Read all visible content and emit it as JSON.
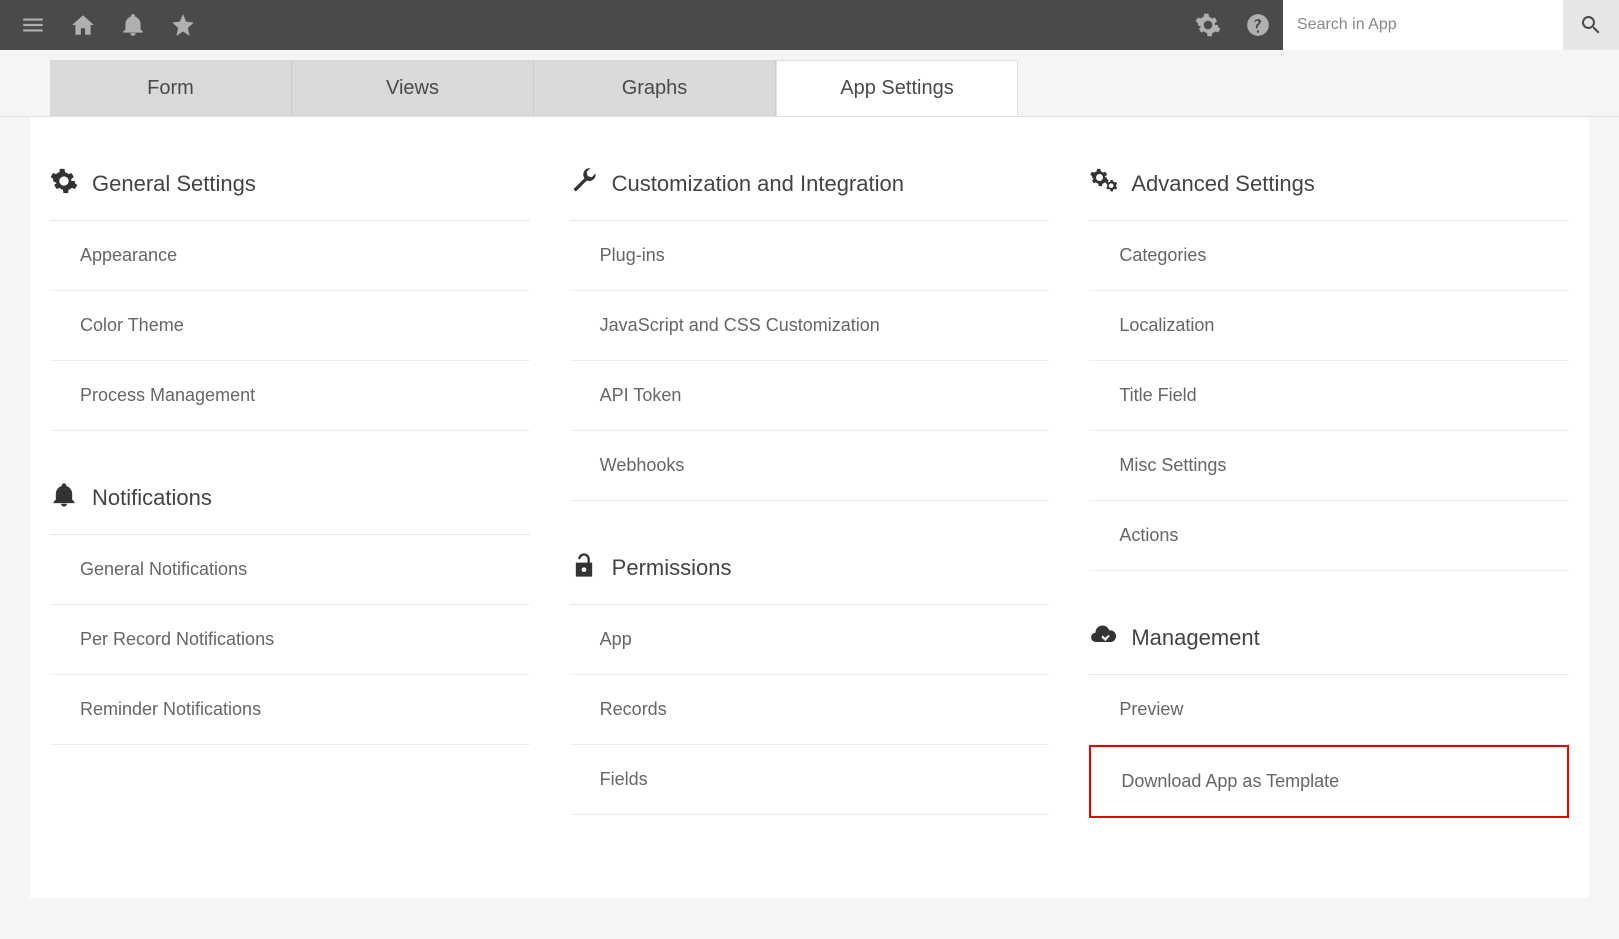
{
  "header": {
    "search_placeholder": "Search in App"
  },
  "tabs": [
    {
      "label": "Form",
      "active": false
    },
    {
      "label": "Views",
      "active": false
    },
    {
      "label": "Graphs",
      "active": false
    },
    {
      "label": "App Settings",
      "active": true
    }
  ],
  "columns": [
    {
      "sections": [
        {
          "icon": "gear",
          "title": "General Settings",
          "items": [
            {
              "label": "Appearance"
            },
            {
              "label": "Color Theme"
            },
            {
              "label": "Process Management"
            }
          ]
        },
        {
          "icon": "bell",
          "title": "Notifications",
          "items": [
            {
              "label": "General Notifications"
            },
            {
              "label": "Per Record Notifications"
            },
            {
              "label": "Reminder Notifications"
            }
          ]
        }
      ]
    },
    {
      "sections": [
        {
          "icon": "wrench",
          "title": "Customization and Integration",
          "items": [
            {
              "label": "Plug-ins"
            },
            {
              "label": "JavaScript and CSS Customization"
            },
            {
              "label": "API Token"
            },
            {
              "label": "Webhooks"
            }
          ]
        },
        {
          "icon": "lock",
          "title": "Permissions",
          "items": [
            {
              "label": "App"
            },
            {
              "label": "Records"
            },
            {
              "label": "Fields"
            }
          ]
        }
      ]
    },
    {
      "sections": [
        {
          "icon": "gears",
          "title": "Advanced Settings",
          "items": [
            {
              "label": "Categories"
            },
            {
              "label": "Localization"
            },
            {
              "label": "Title Field"
            },
            {
              "label": "Misc Settings"
            },
            {
              "label": "Actions"
            }
          ]
        },
        {
          "icon": "cloud",
          "title": "Management",
          "items": [
            {
              "label": "Preview"
            },
            {
              "label": "Download App as Template",
              "highlight": true
            }
          ]
        }
      ]
    }
  ]
}
